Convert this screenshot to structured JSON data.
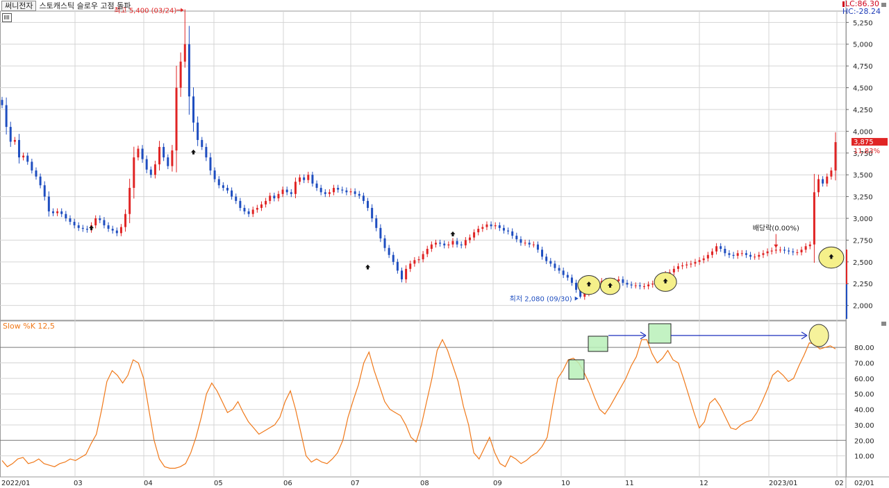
{
  "header": {
    "stock_name": "써니전자",
    "study_title": "스토캐스틱 슬로우 고점 돌파"
  },
  "indicators": {
    "lc": "LC:86.30",
    "hc": "HC:-28.24"
  },
  "price_labels": {
    "high": "최고 5,400 (03/24)",
    "low": "최저 2,080 (09/30)",
    "dividend": "배당락(0.00%)",
    "current_price": "3,875",
    "current_change": "11.83%"
  },
  "oscillator": {
    "label": "Slow %K 12,5"
  },
  "colors": {
    "up": "#e02424",
    "down": "#1f4ec0",
    "stoch": "#f07818",
    "grid": "#d4d4d4",
    "highlight_circle": "#f5f08a",
    "highlight_box": "#b8f0b8",
    "arrow": "#1a2dbd"
  },
  "chart_data": [
    {
      "type": "candlestick",
      "title": "",
      "x_tick_labels": [
        "2022/01",
        "03",
        "04",
        "05",
        "06",
        "07",
        "08",
        "09",
        "10",
        "11",
        "12",
        "2023/01",
        "02",
        "02/01"
      ],
      "y_tick_labels": [
        "5,250",
        "5,000",
        "4,750",
        "4,500",
        "4,250",
        "4,000",
        "3,750",
        "3,500",
        "3,250",
        "3,000",
        "2,750",
        "2,500",
        "2,250",
        "2,000"
      ],
      "ylim": [
        1830,
        5380
      ],
      "grid": true,
      "closes": [
        4300,
        4050,
        3880,
        3900,
        3700,
        3720,
        3650,
        3550,
        3480,
        3380,
        3250,
        3080,
        3060,
        3080,
        3050,
        3000,
        2960,
        2920,
        2890,
        2880,
        2870,
        2920,
        3000,
        2980,
        2920,
        2880,
        2860,
        2830,
        2900,
        3050,
        3350,
        3700,
        3800,
        3680,
        3560,
        3500,
        3620,
        3820,
        3700,
        3600,
        3780,
        4500,
        4800,
        5000,
        4400,
        4100,
        3900,
        3820,
        3700,
        3550,
        3450,
        3380,
        3350,
        3320,
        3250,
        3200,
        3120,
        3080,
        3050,
        3100,
        3120,
        3160,
        3200,
        3260,
        3230,
        3280,
        3330,
        3300,
        3280,
        3420,
        3470,
        3440,
        3500,
        3400,
        3350,
        3300,
        3280,
        3300,
        3350,
        3330,
        3320,
        3300,
        3310,
        3280,
        3260,
        3200,
        3120,
        3000,
        2890,
        2770,
        2660,
        2580,
        2500,
        2400,
        2300,
        2420,
        2480,
        2520,
        2530,
        2590,
        2650,
        2700,
        2720,
        2710,
        2690,
        2700,
        2740,
        2700,
        2690,
        2750,
        2780,
        2840,
        2880,
        2900,
        2930,
        2910,
        2920,
        2890,
        2860,
        2850,
        2800,
        2760,
        2720,
        2720,
        2700,
        2700,
        2640,
        2560,
        2510,
        2480,
        2430,
        2400,
        2350,
        2320,
        2260,
        2180,
        2100,
        2140,
        2180,
        2230,
        2250,
        2280,
        2210,
        2250,
        2280,
        2300,
        2260,
        2240,
        2230,
        2230,
        2220,
        2220,
        2240,
        2250,
        2300,
        2330,
        2360,
        2380,
        2420,
        2450,
        2460,
        2470,
        2480,
        2500,
        2520,
        2540,
        2580,
        2620,
        2680,
        2650,
        2600,
        2580,
        2570,
        2600,
        2600,
        2580,
        2560,
        2560,
        2580,
        2600,
        2620,
        2630,
        2640,
        2640,
        2630,
        2620,
        2610,
        2610,
        2640,
        2680,
        2700,
        3300,
        3450,
        3400,
        3480,
        3550,
        3875
      ],
      "stoch_k": [
        7,
        3,
        5,
        8,
        9,
        5,
        6,
        8,
        5,
        4,
        3,
        5,
        6,
        8,
        7,
        9,
        11,
        18,
        24,
        40,
        58,
        65,
        62,
        57,
        62,
        72,
        70,
        60,
        40,
        20,
        8,
        3,
        2,
        2,
        3,
        5,
        12,
        22,
        35,
        50,
        57,
        52,
        45,
        38,
        40,
        45,
        38,
        32,
        28,
        24,
        26,
        28,
        30,
        35,
        45,
        52,
        40,
        25,
        10,
        6,
        8,
        6,
        5,
        8,
        12,
        20,
        35,
        46,
        56,
        70,
        77,
        65,
        55,
        45,
        40,
        38,
        36,
        30,
        22,
        19,
        30,
        45,
        60,
        78,
        85,
        78,
        68,
        58,
        42,
        30,
        12,
        8,
        15,
        22,
        12,
        5,
        3,
        10,
        8,
        5,
        7,
        10,
        12,
        16,
        22,
        42,
        60,
        65,
        72,
        73,
        70,
        64,
        57,
        48,
        40,
        37,
        42,
        48,
        54,
        60,
        68,
        74,
        85,
        85,
        76,
        70,
        73,
        78,
        72,
        70,
        60,
        49,
        38,
        28,
        32,
        44,
        47,
        42,
        35,
        28,
        27,
        30,
        32,
        33,
        38,
        45,
        53,
        62,
        65,
        62,
        58,
        60,
        68,
        75,
        83,
        82,
        79,
        80,
        81,
        79
      ]
    }
  ]
}
